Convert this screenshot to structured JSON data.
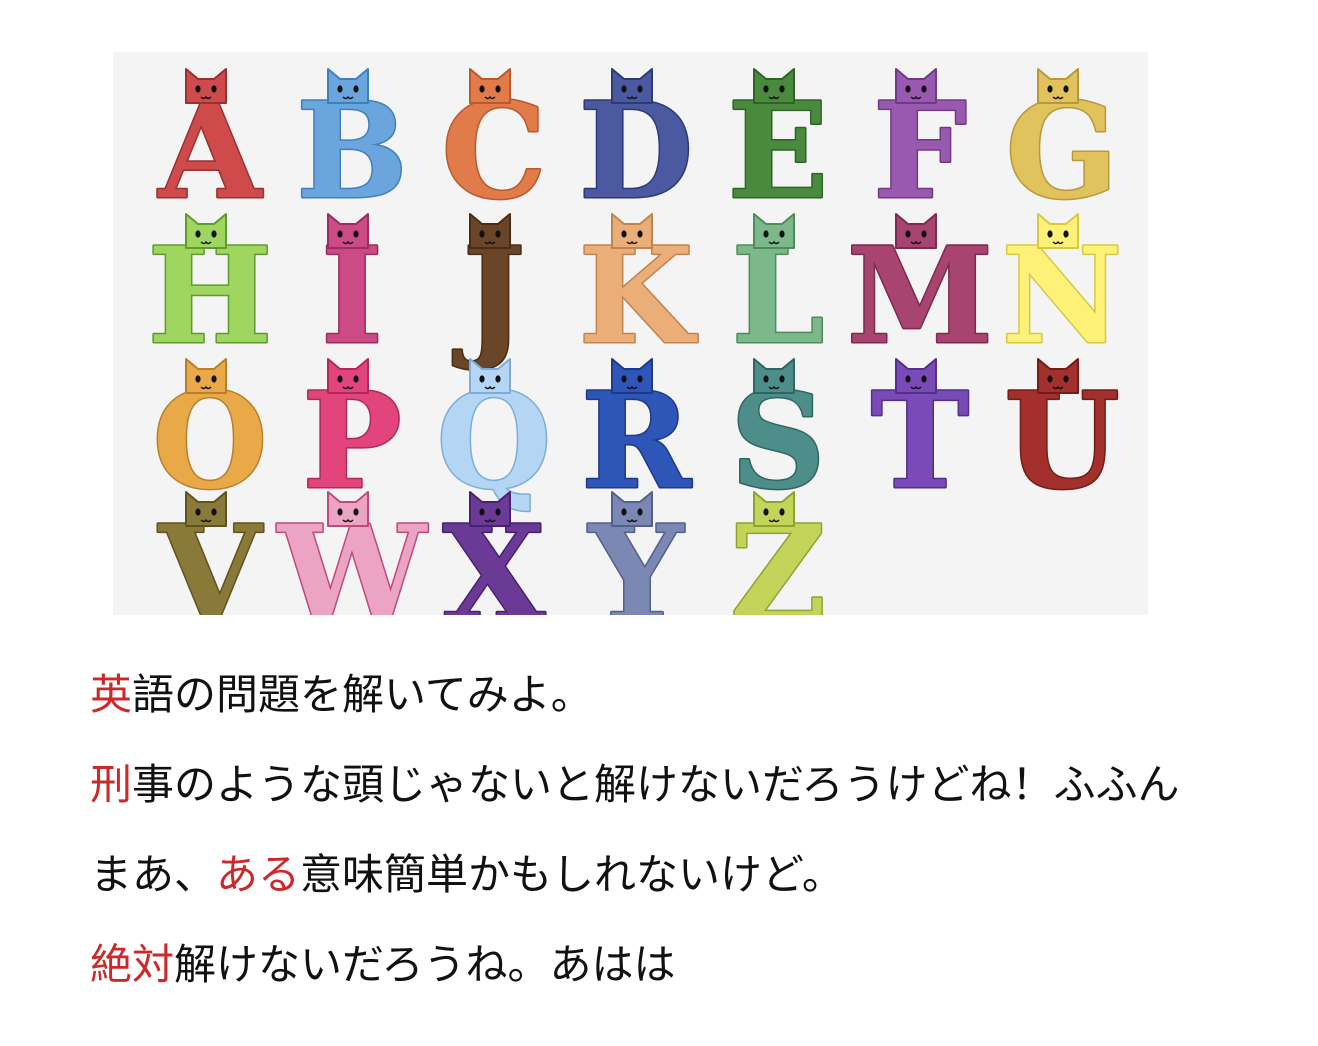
{
  "alphabet": [
    {
      "letter": "A",
      "fill": "#cf4a4a",
      "stroke": "#9a3030"
    },
    {
      "letter": "B",
      "fill": "#6aa6dd",
      "stroke": "#3f7fc0"
    },
    {
      "letter": "C",
      "fill": "#e27b4a",
      "stroke": "#b85a2c"
    },
    {
      "letter": "D",
      "fill": "#4b5aa0",
      "stroke": "#2d3a78"
    },
    {
      "letter": "E",
      "fill": "#4a8a3e",
      "stroke": "#2f6426"
    },
    {
      "letter": "F",
      "fill": "#9a59b0",
      "stroke": "#703a85"
    },
    {
      "letter": "G",
      "fill": "#e0c35c",
      "stroke": "#b8983a"
    },
    {
      "letter": "H",
      "fill": "#9ed660",
      "stroke": "#5f9a30"
    },
    {
      "letter": "I",
      "fill": "#cc4a86",
      "stroke": "#9a2e60"
    },
    {
      "letter": "J",
      "fill": "#6b4527",
      "stroke": "#4a2c14"
    },
    {
      "letter": "K",
      "fill": "#ecae78",
      "stroke": "#c0844e"
    },
    {
      "letter": "L",
      "fill": "#7cb88a",
      "stroke": "#4e8c5c"
    },
    {
      "letter": "M",
      "fill": "#a84470",
      "stroke": "#7c2a50"
    },
    {
      "letter": "N",
      "fill": "#fdf178",
      "stroke": "#d8c840"
    },
    {
      "letter": "O",
      "fill": "#eaa948",
      "stroke": "#b8802a"
    },
    {
      "letter": "P",
      "fill": "#e2447c",
      "stroke": "#b02a58"
    },
    {
      "letter": "Q",
      "fill": "#b4d6f4",
      "stroke": "#7aaed8"
    },
    {
      "letter": "R",
      "fill": "#2e56b8",
      "stroke": "#1e3a86"
    },
    {
      "letter": "S",
      "fill": "#4e8e8a",
      "stroke": "#2e6662"
    },
    {
      "letter": "T",
      "fill": "#7a4ab8",
      "stroke": "#52308a"
    },
    {
      "letter": "U",
      "fill": "#a3302c",
      "stroke": "#741c18"
    },
    {
      "letter": "V",
      "fill": "#8a7a3a",
      "stroke": "#605220"
    },
    {
      "letter": "W",
      "fill": "#eca4c4",
      "stroke": "#c0487c"
    },
    {
      "letter": "X",
      "fill": "#6a3a96",
      "stroke": "#48226c"
    },
    {
      "letter": "Y",
      "fill": "#7c88b4",
      "stroke": "#54608c"
    },
    {
      "letter": "Z",
      "fill": "#c4d45a",
      "stroke": "#8ea432"
    }
  ],
  "text_lines": [
    {
      "highlight": "英",
      "rest": "語の問題を解いてみよ。"
    },
    {
      "highlight": "刑",
      "rest": "事のような頭じゃないと解けないだろうけどね！ふふん"
    },
    {
      "prefix": "まあ、",
      "highlight": "ある",
      "rest": "意味簡単かもしれないけど。"
    },
    {
      "highlight": "絶対",
      "rest": "解けないだろうね。あはは"
    }
  ],
  "colors": {
    "highlight": "#cc2a2a",
    "text": "#111111",
    "panel_bg": "#f4f4f4"
  }
}
